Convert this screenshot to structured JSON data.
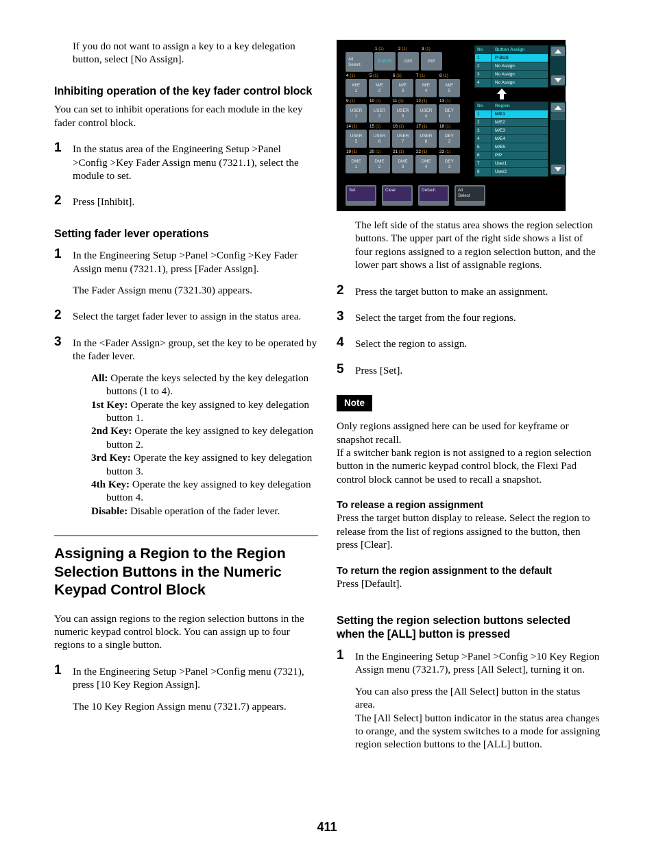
{
  "page": {
    "number": "411"
  },
  "left_column": {
    "intro": "If you do not want to assign a key to a key delegation button, select [No Assign].",
    "heading_inhibit": "Inhibiting operation of the key fader control block",
    "inhibit_body": "You can set to inhibit operations for each module in the key fader control block.",
    "inhibit_steps": [
      {
        "num": "1",
        "text": "In the status area of the Engineering Setup >Panel >Config >Key Fader Assign menu (7321.1), select the module to set."
      },
      {
        "num": "2",
        "text": "Press [Inhibit]."
      }
    ],
    "heading_fader": "Setting fader lever operations",
    "fader_steps": [
      {
        "num": "1",
        "text": "In the Engineering Setup >Panel >Config >Key Fader Assign menu (7321.1), press [Fader Assign]."
      }
    ],
    "fader_step1_note": "The Fader Assign menu (7321.30) appears.",
    "fader_step2": {
      "num": "2",
      "text": "Select the target fader lever to assign in the status area."
    },
    "fader_step3": {
      "num": "3",
      "text": "In the <Fader Assign> group, set the key to be operated by the fader lever."
    },
    "fader_definitions": [
      {
        "term": "All:",
        "desc": "Operate the keys selected by the key delegation buttons (1 to 4)."
      },
      {
        "term": "1st Key:",
        "desc": "Operate the key assigned to key delegation button 1."
      },
      {
        "term": "2nd Key:",
        "desc": "Operate the key assigned to key delegation button 2."
      },
      {
        "term": "3rd Key:",
        "desc": "Operate the key assigned to key delegation button 3."
      },
      {
        "term": "4th Key:",
        "desc": "Operate the key assigned to key delegation button 4."
      },
      {
        "term": "Disable:",
        "desc": "Disable operation of the fader lever."
      }
    ],
    "heading_assigning": "Assigning a Region to the Region Selection Buttons in the Numeric Keypad Control Block",
    "assigning_body": "You can assign regions to the region selection buttons in the numeric keypad control block. You can assign up to four regions to a single button.",
    "assigning_step1": {
      "num": "1",
      "text": "In the Engineering Setup >Panel >Config menu (7321), press [10 Key Region Assign]."
    },
    "assigning_step1_note": "The 10 Key Region Assign menu (7321.7) appears."
  },
  "panel": {
    "all_select_label_line1": "All",
    "all_select_label_line2": "Select",
    "buttons": [
      {
        "cap": "1",
        "paren": "(1)",
        "l1": "P-BUS",
        "l2": "",
        "state": "active"
      },
      {
        "cap": "2",
        "paren": "(1)",
        "l1": "GPI",
        "l2": "",
        "state": "normal"
      },
      {
        "cap": "3",
        "paren": "(1)",
        "l1": "P/P",
        "l2": "",
        "state": "normal"
      },
      {
        "cap": "4",
        "paren": "(1)",
        "l1": "M/E",
        "l2": "1",
        "state": "normal"
      },
      {
        "cap": "5",
        "paren": "(1)",
        "l1": "M/E",
        "l2": "2",
        "state": "normal"
      },
      {
        "cap": "6",
        "paren": "(1)",
        "l1": "M/E",
        "l2": "3",
        "state": "normal"
      },
      {
        "cap": "7",
        "paren": "(1)",
        "l1": "M/E",
        "l2": "4",
        "state": "normal"
      },
      {
        "cap": "8",
        "paren": "(1)",
        "l1": "M/E",
        "l2": "5",
        "state": "normal"
      },
      {
        "cap": "9",
        "paren": "(1)",
        "l1": "USER",
        "l2": "1",
        "state": "normal"
      },
      {
        "cap": "10",
        "paren": "(1)",
        "l1": "USER",
        "l2": "2",
        "state": "normal"
      },
      {
        "cap": "11",
        "paren": "(1)",
        "l1": "USER",
        "l2": "3",
        "state": "normal"
      },
      {
        "cap": "12",
        "paren": "(1)",
        "l1": "USER",
        "l2": "4",
        "state": "normal"
      },
      {
        "cap": "13",
        "paren": "(1)",
        "l1": "DEY",
        "l2": "1",
        "state": "normal"
      },
      {
        "cap": "14",
        "paren": "(1)",
        "l1": "USER",
        "l2": "5",
        "state": "normal"
      },
      {
        "cap": "15",
        "paren": "(1)",
        "l1": "USER",
        "l2": "6",
        "state": "normal"
      },
      {
        "cap": "16",
        "paren": "(1)",
        "l1": "USER",
        "l2": "7",
        "state": "normal"
      },
      {
        "cap": "17",
        "paren": "(1)",
        "l1": "USER",
        "l2": "8",
        "state": "normal"
      },
      {
        "cap": "18",
        "paren": "(1)",
        "l1": "DEY",
        "l2": "2",
        "state": "normal"
      },
      {
        "cap": "19",
        "paren": "(1)",
        "l1": "DME",
        "l2": "1",
        "state": "normal"
      },
      {
        "cap": "20",
        "paren": "(1)",
        "l1": "DME",
        "l2": "2",
        "state": "normal"
      },
      {
        "cap": "21",
        "paren": "(1)",
        "l1": "DME",
        "l2": "3",
        "state": "normal"
      },
      {
        "cap": "22",
        "paren": "(1)",
        "l1": "DME",
        "l2": "4",
        "state": "normal"
      },
      {
        "cap": "23",
        "paren": "(1)",
        "l1": "DEY",
        "l2": "3",
        "state": "normal"
      }
    ],
    "actions": [
      {
        "label": "Set",
        "style": "purple"
      },
      {
        "label": "Clear",
        "style": "purple"
      },
      {
        "label": "Default",
        "style": "purple"
      },
      {
        "label": "All\nSelect",
        "style": "dark"
      }
    ],
    "button_assign_table": {
      "header": {
        "no": "No",
        "value": "Button Assign"
      },
      "rows": [
        {
          "no": "1",
          "value": "P-BUS",
          "selected": true
        },
        {
          "no": "2",
          "value": "No Assign",
          "selected": false
        },
        {
          "no": "3",
          "value": "No Assign",
          "selected": false
        },
        {
          "no": "4",
          "value": "No Assign",
          "selected": false
        }
      ]
    },
    "region_table": {
      "header": {
        "no": "No",
        "value": "Region"
      },
      "rows": [
        {
          "no": "1",
          "value": "M/E1",
          "selected": true
        },
        {
          "no": "2",
          "value": "M/E2",
          "selected": false
        },
        {
          "no": "3",
          "value": "M/E3",
          "selected": false
        },
        {
          "no": "4",
          "value": "M/E4",
          "selected": false
        },
        {
          "no": "5",
          "value": "M/E5",
          "selected": false
        },
        {
          "no": "6",
          "value": "P/P",
          "selected": false
        },
        {
          "no": "7",
          "value": "User1",
          "selected": false
        },
        {
          "no": "8",
          "value": "User2",
          "selected": false
        }
      ]
    },
    "colors": {
      "background": "#000000",
      "button_face": "#6c7b86",
      "active_text": "#38e0d8",
      "caption_paren": "#e08a1e",
      "table_row": "#1b666e",
      "table_header": "#143d45",
      "table_selected": "#13cdeb",
      "action_purple": "#3d2a63"
    }
  },
  "right_column": {
    "caption": "The left side of the status area shows the region selection buttons. The upper part of the right side shows a list of four regions assigned to a region selection button, and the lower part shows a list of assignable regions.",
    "steps": [
      {
        "num": "2",
        "text": "Press the target button to make an assignment."
      },
      {
        "num": "3",
        "text": "Select the target from the four regions."
      },
      {
        "num": "4",
        "text": "Select the region to assign."
      },
      {
        "num": "5",
        "text": "Press [Set]."
      }
    ],
    "note_label": "Note",
    "note_text": "Only regions assigned here can be used for keyframe or snapshot recall.\nIf a switcher bank region is not assigned to a region selection button in the numeric keypad control block, the Flexi Pad control block cannot be used to recall a snapshot.",
    "release_heading": "To release a region assignment",
    "release_body": "Press the target button display to release. Select the region to release from the list of regions assigned to the button, then press [Clear].",
    "default_heading": "To return the region assignment to the default",
    "default_body": "Press [Default].",
    "allbtn_heading": "Setting the region selection buttons selected when the [ALL] button is pressed",
    "allbtn_step1": {
      "num": "1",
      "text": "In the Engineering Setup >Panel >Config >10 Key Region Assign menu (7321.7), press [All Select], turning it on."
    },
    "allbtn_note1": "You can also press the [All Select] button in the status area.\nThe [All Select] button indicator in the status area changes to orange, and the system switches to a mode for assigning region selection buttons to the [ALL] button."
  }
}
